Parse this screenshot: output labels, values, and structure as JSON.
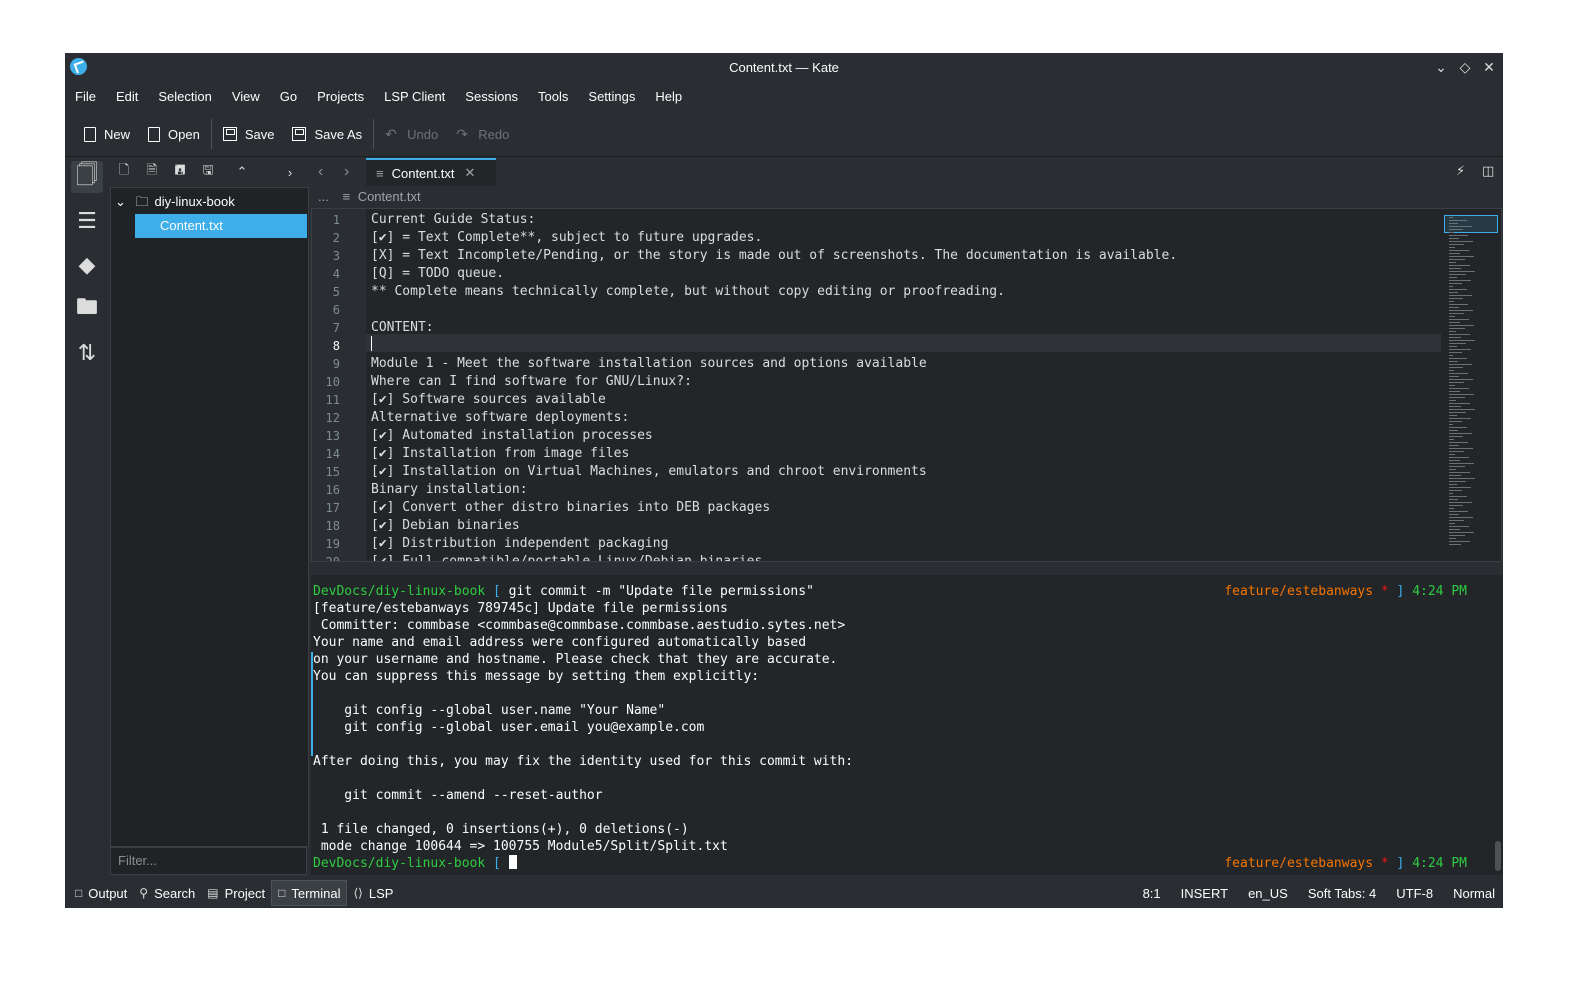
{
  "window": {
    "title": "Content.txt — Kate"
  },
  "menu": [
    "File",
    "Edit",
    "Selection",
    "View",
    "Go",
    "Projects",
    "LSP Client",
    "Sessions",
    "Tools",
    "Settings",
    "Help"
  ],
  "toolbar": {
    "new_label": "New",
    "open_label": "Open",
    "save_label": "Save",
    "save_as_label": "Save As",
    "undo_label": "Undo",
    "redo_label": "Redo"
  },
  "file_tree": {
    "folder": "diy-linux-book",
    "file": "Content.txt",
    "filter_placeholder": "Filter..."
  },
  "tab": {
    "label": "Content.txt"
  },
  "breadcrumb": {
    "ellipsis": "...",
    "file": "Content.txt"
  },
  "editor": {
    "current_line": 8,
    "lines": [
      "Current Guide Status:",
      "[✔] = Text Complete**, subject to future upgrades.",
      "[X] = Text Incomplete/Pending, or the story is made out of screenshots. The documentation is available.",
      "[Q] = TODO queue.",
      "** Complete means technically complete, but without copy editing or proofreading.",
      "",
      "CONTENT:",
      "",
      "Module 1 - Meet the software installation sources and options available",
      "Where can I find software for GNU/Linux?:",
      "[✔] Software sources available",
      "Alternative software deployments:",
      "[✔] Automated installation processes",
      "[✔] Installation from image files",
      "[✔] Installation on Virtual Machines, emulators and chroot environments",
      "Binary installation:",
      "[✔] Convert other distro binaries into DEB packages",
      "[✔] Debian binaries",
      "[✔] Distribution independent packaging",
      "[✔] Full compatible/portable Linux/Debian binaries"
    ]
  },
  "terminal": {
    "prompt_path": "DevDocs/diy-linux-book",
    "prompt_open": "[",
    "prompt_close": "]",
    "branch": "feature/estebanways",
    "dirty_mark": "*",
    "time": "4:24 PM",
    "command": " git commit -m \"Update file permissions\"",
    "output": [
      "[feature/estebanways 789745c] Update file permissions",
      " Committer: commbase <commbase@commbase.commbase.aestudio.sytes.net>",
      "Your name and email address were configured automatically based",
      "on your username and hostname. Please check that they are accurate.",
      "You can suppress this message by setting them explicitly:",
      "",
      "    git config --global user.name \"Your Name\"",
      "    git config --global user.email you@example.com",
      "",
      "After doing this, you may fix the identity used for this commit with:",
      "",
      "    git commit --amend --reset-author",
      "",
      " 1 file changed, 0 insertions(+), 0 deletions(-)",
      " mode change 100644 => 100755 Module5/Split/Split.txt"
    ]
  },
  "statusbar": {
    "tabs": [
      "Output",
      "Search",
      "Project",
      "Terminal",
      "LSP"
    ],
    "active_tab": "Terminal",
    "cursor_pos": "8:1",
    "mode": "INSERT",
    "language": "en_US",
    "indent": "Soft Tabs: 4",
    "encoding": "UTF-8",
    "input_mode": "Normal"
  }
}
